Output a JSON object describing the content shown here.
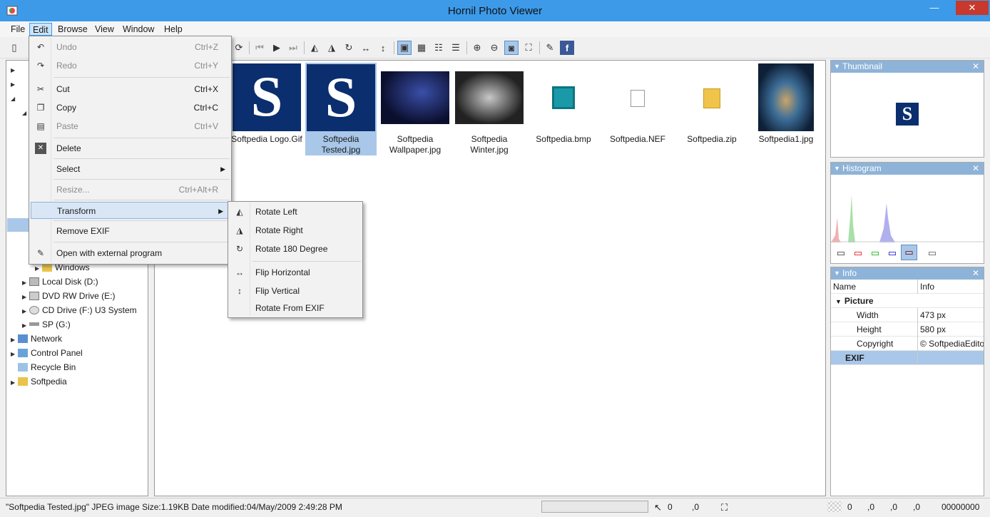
{
  "window": {
    "title": "Hornil Photo Viewer",
    "min_icon": "minimize-icon",
    "max_icon": "maximize-icon",
    "close_icon": "close-icon",
    "close_glyph": "✕",
    "min_glyph": "—",
    "max_glyph": "☐"
  },
  "menubar": {
    "items": [
      "File",
      "Edit",
      "Browse",
      "View",
      "Window",
      "Help"
    ]
  },
  "edit_menu": {
    "items": [
      {
        "label": "Undo",
        "shortcut": "Ctrl+Z",
        "icon": "undo-icon",
        "disabled": true
      },
      {
        "label": "Redo",
        "shortcut": "Ctrl+Y",
        "icon": "redo-icon",
        "disabled": true
      },
      {
        "label": "Cut",
        "shortcut": "Ctrl+X",
        "icon": "scissors-icon"
      },
      {
        "label": "Copy",
        "shortcut": "Ctrl+C",
        "icon": "copy-icon"
      },
      {
        "label": "Paste",
        "shortcut": "Ctrl+V",
        "icon": "paste-icon",
        "disabled": true
      },
      {
        "label": "Delete",
        "icon": "delete-icon"
      },
      {
        "label": "Select",
        "submenu": true
      },
      {
        "label": "Resize...",
        "shortcut": "Ctrl+Alt+R",
        "disabled": true
      },
      {
        "label": "Transform",
        "submenu": true,
        "highlighted": true
      },
      {
        "label": "Remove EXIF"
      },
      {
        "label": "Open with external program",
        "icon": "external-program-icon"
      }
    ]
  },
  "transform_submenu": {
    "items": [
      {
        "label": "Rotate Left",
        "icon": "rotate-left-icon"
      },
      {
        "label": "Rotate Right",
        "icon": "rotate-right-icon"
      },
      {
        "label": "Rotate 180 Degree",
        "icon": "rotate-180-icon"
      },
      {
        "label": "Flip Horizontal",
        "icon": "flip-horizontal-icon"
      },
      {
        "label": "Flip Vertical",
        "icon": "flip-vertical-icon"
      },
      {
        "label": "Rotate From EXIF"
      }
    ]
  },
  "tree": {
    "items": [
      {
        "label": "Windows",
        "icon": "folder-icon"
      },
      {
        "label": "Local Disk (D:)",
        "icon": "drive-icon"
      },
      {
        "label": "DVD RW Drive (E:)",
        "icon": "dvd-drive-icon"
      },
      {
        "label": "CD Drive (F:) U3 System",
        "icon": "cd-drive-icon"
      },
      {
        "label": "SP (G:)",
        "icon": "usb-drive-icon"
      },
      {
        "label": "Network",
        "icon": "network-icon"
      },
      {
        "label": "Control Panel",
        "icon": "control-panel-icon"
      },
      {
        "label": "Recycle Bin",
        "icon": "recycle-bin-icon"
      },
      {
        "label": "Softpedia",
        "icon": "folder-icon"
      }
    ]
  },
  "thumbnails": [
    {
      "caption": "Softpedia Logo.Gif"
    },
    {
      "caption": "Softpedia Tested.jpg",
      "selected": true
    },
    {
      "caption": "Softpedia Wallpaper.jpg"
    },
    {
      "caption": "Softpedia Winter.jpg"
    },
    {
      "caption": "Softpedia.bmp",
      "icon": "bitmap-file-icon"
    },
    {
      "caption": "Softpedia.NEF",
      "icon": "image-file-icon"
    },
    {
      "caption": "Softpedia.zip",
      "icon": "zip-folder-icon"
    },
    {
      "caption": "Softpedia1.jpg"
    }
  ],
  "logo_letter": "S",
  "panels": {
    "thumbnail": {
      "title": "Thumbnail"
    },
    "histogram": {
      "title": "Histogram"
    },
    "info": {
      "title": "Info",
      "headers": [
        "Name",
        "Info"
      ],
      "group": "Picture",
      "rows": [
        {
          "name": "Width",
          "value": "473 px"
        },
        {
          "name": "Height",
          "value": "580 px"
        },
        {
          "name": "Copyright",
          "value": "© SoftpediaEdito"
        }
      ],
      "exif_label": "EXIF"
    }
  },
  "status": {
    "file_info": "\"Softpedia Tested.jpg\" JPEG image Size:1.19KB Date modified:04/May/2009 2:49:28 PM",
    "cursor_x": "0",
    "cursor_y": ",0",
    "rgb": [
      "0",
      ",0",
      ",0",
      ",0"
    ],
    "color_hex": "00000000"
  },
  "colors": {
    "title_bar": "#3c9ae9",
    "selection": "#a9c7e8",
    "close_button": "#c7392c",
    "logo_bg": "#0b2e6e"
  }
}
